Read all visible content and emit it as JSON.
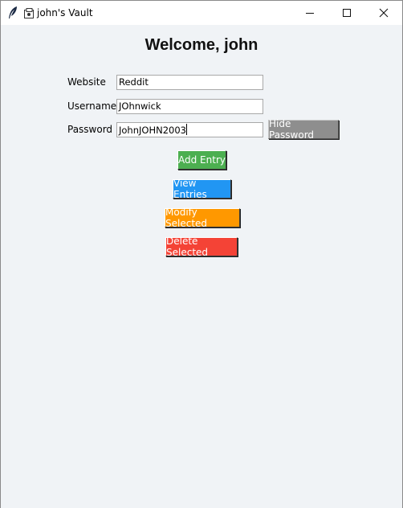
{
  "window": {
    "title": "john's Vault",
    "icons": [
      "feather-icon",
      "app-icon",
      "minimize-icon",
      "maximize-icon",
      "close-icon"
    ]
  },
  "main": {
    "welcome_text": "Welcome, john",
    "fields": {
      "website_label": "Website",
      "website_value": "Reddit",
      "username_label": "Username",
      "username_value": "JOhnwick",
      "password_label": "Password",
      "password_value": "JohnJOHN2003"
    },
    "buttons": {
      "hide_password": "Hide Password",
      "add_entry": "Add Entry",
      "view_entries": "View Entries",
      "modify_selected": "Modify Selected",
      "delete_selected": "Delete Selected"
    }
  },
  "colors": {
    "background": "#f0f3f6",
    "hide_button": "#8e8e8e",
    "add_button": "#4caf50",
    "view_button": "#2196f3",
    "modify_button": "#ff9800",
    "delete_button": "#f44336"
  }
}
